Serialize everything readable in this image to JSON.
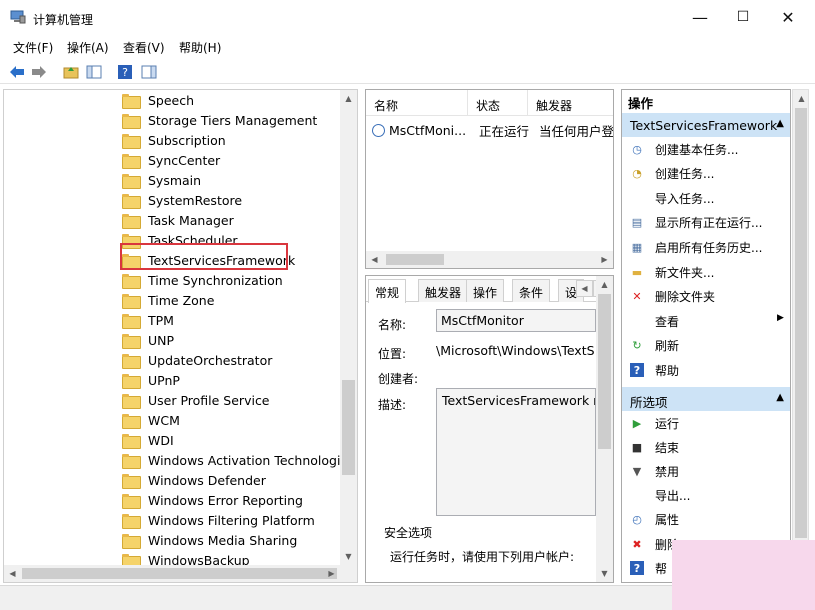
{
  "window": {
    "title": "计算机管理",
    "controls": {
      "minimize": "—",
      "maximize": "☐",
      "close": "✕"
    }
  },
  "menu": [
    "文件(F)",
    "操作(A)",
    "查看(V)",
    "帮助(H)"
  ],
  "tree": {
    "items": [
      {
        "label": "Speech"
      },
      {
        "label": "Storage Tiers Management"
      },
      {
        "label": "Subscription"
      },
      {
        "label": "SyncCenter"
      },
      {
        "label": "Sysmain"
      },
      {
        "label": "SystemRestore"
      },
      {
        "label": "Task Manager"
      },
      {
        "label": "TaskScheduler"
      },
      {
        "label": "TextServicesFramework"
      },
      {
        "label": "Time Synchronization"
      },
      {
        "label": "Time Zone"
      },
      {
        "label": "TPM"
      },
      {
        "label": "UNP"
      },
      {
        "label": "UpdateOrchestrator"
      },
      {
        "label": "UPnP"
      },
      {
        "label": "User Profile Service"
      },
      {
        "label": "WCM"
      },
      {
        "label": "WDI"
      },
      {
        "label": "Windows Activation Technologies"
      },
      {
        "label": "Windows Defender"
      },
      {
        "label": "Windows Error Reporting"
      },
      {
        "label": "Windows Filtering Platform"
      },
      {
        "label": "Windows Media Sharing"
      },
      {
        "label": "WindowsBackup"
      }
    ],
    "selected": "TextServicesFramework"
  },
  "tasklist": {
    "columns": [
      "名称",
      "状态",
      "触发器"
    ],
    "rows": [
      {
        "name": "MsCtfMoni...",
        "status": "正在运行",
        "trigger": "当任何用户登录"
      }
    ]
  },
  "detail": {
    "tabs": [
      "常规",
      "触发器",
      "操作",
      "条件",
      "设"
    ],
    "active_tab": "常规",
    "name_label": "名称:",
    "name_value": "MsCtfMonitor",
    "location_label": "位置:",
    "location_value": "\\Microsoft\\Windows\\TextS",
    "author_label": "创建者:",
    "author_value": "",
    "desc_label": "描述:",
    "desc_value": "TextServicesFramework m",
    "security_label": "安全选项",
    "security_row": "运行任务时，请使用下列用户帐户:"
  },
  "actions": {
    "header": "操作",
    "section1": {
      "title": "TextServicesFramework",
      "items": [
        {
          "label": "创建基本任务...",
          "icon": "basic-task-icon"
        },
        {
          "label": "创建任务...",
          "icon": "create-task-icon"
        },
        {
          "label": "导入任务...",
          "icon": "import-icon"
        },
        {
          "label": "显示所有正在运行...",
          "icon": "running-tasks-icon"
        },
        {
          "label": "启用所有任务历史...",
          "icon": "history-icon"
        },
        {
          "label": "新文件夹...",
          "icon": "new-folder-icon"
        },
        {
          "label": "删除文件夹",
          "icon": "delete-folder-icon"
        },
        {
          "label": "查看",
          "icon": "view-icon"
        },
        {
          "label": "刷新",
          "icon": "refresh-icon"
        },
        {
          "label": "帮助",
          "icon": "help-icon"
        }
      ]
    },
    "section2": {
      "title": "所选项",
      "items": [
        {
          "label": "运行",
          "icon": "run-icon"
        },
        {
          "label": "结束",
          "icon": "end-icon"
        },
        {
          "label": "禁用",
          "icon": "disable-icon"
        },
        {
          "label": "导出...",
          "icon": "export-icon"
        },
        {
          "label": "属性",
          "icon": "properties-icon"
        },
        {
          "label": "删除",
          "icon": "delete-icon"
        },
        {
          "label": "帮",
          "icon": "help-icon"
        }
      ]
    }
  },
  "colors": {
    "selection_outline": "#d9363e",
    "section_bg": "#cde3f6",
    "accent_blue": "#2a6fc9"
  }
}
